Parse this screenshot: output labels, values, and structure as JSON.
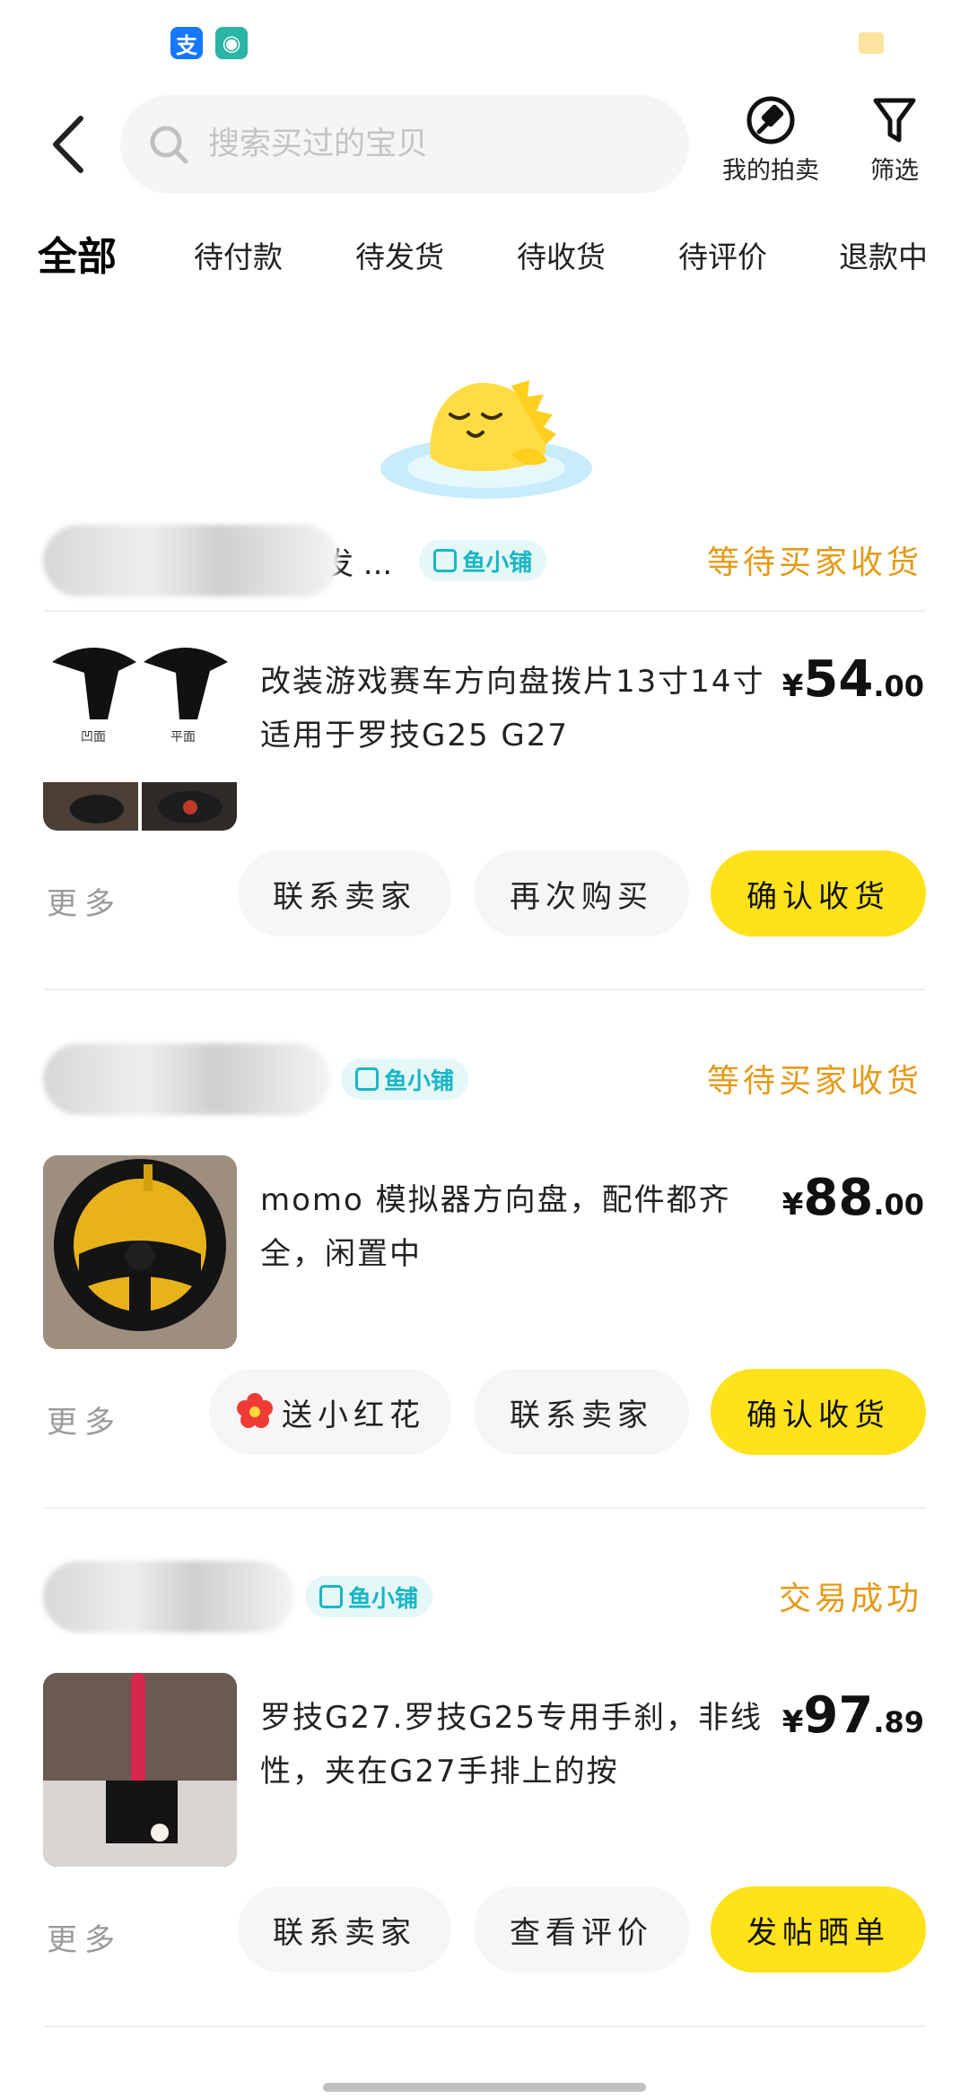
{
  "status_bar": {
    "alipay_glyph": "支",
    "chat_glyph": "◉"
  },
  "header": {
    "search_placeholder": "搜索买过的宝贝",
    "my_auction_label": "我的拍卖",
    "filter_label": "筛选"
  },
  "tabs": [
    {
      "label": "全部",
      "active": true
    },
    {
      "label": "待付款"
    },
    {
      "label": "待发货"
    },
    {
      "label": "待收货"
    },
    {
      "label": "待评价"
    },
    {
      "label": "退款中"
    }
  ],
  "shop_badge_label": "鱼小铺",
  "more_label": "更多",
  "orders": [
    {
      "seller_name_visible": "发 ...",
      "status": "等待买家收货",
      "title": "改装游戏赛车方向盘拨片13寸14寸适用于罗技G25 G27",
      "price": {
        "currency": "¥",
        "integer": "54",
        "decimal": ".00"
      },
      "thumb_labels": [
        "凹面",
        "平面"
      ],
      "buttons": [
        "联系卖家",
        "再次购买",
        "确认收货"
      ]
    },
    {
      "seller_name_visible": "",
      "status": "等待买家收货",
      "title": "momo 模拟器方向盘，配件都齐全，闲置中",
      "price": {
        "currency": "¥",
        "integer": "88",
        "decimal": ".00"
      },
      "buttons": [
        "送小红花",
        "联系卖家",
        "确认收货"
      ]
    },
    {
      "seller_name_visible": "",
      "status": "交易成功",
      "title": "罗技G27.罗技G25专用手刹，非线性，夹在G27手排上的按",
      "price": {
        "currency": "¥",
        "integer": "97",
        "decimal": ".89"
      },
      "buttons": [
        "联系卖家",
        "查看评价",
        "发帖晒单"
      ]
    }
  ],
  "colors": {
    "accent_yellow": "#ffe21a",
    "status_orange": "#e49a16",
    "badge_teal": "#16b7c6"
  }
}
